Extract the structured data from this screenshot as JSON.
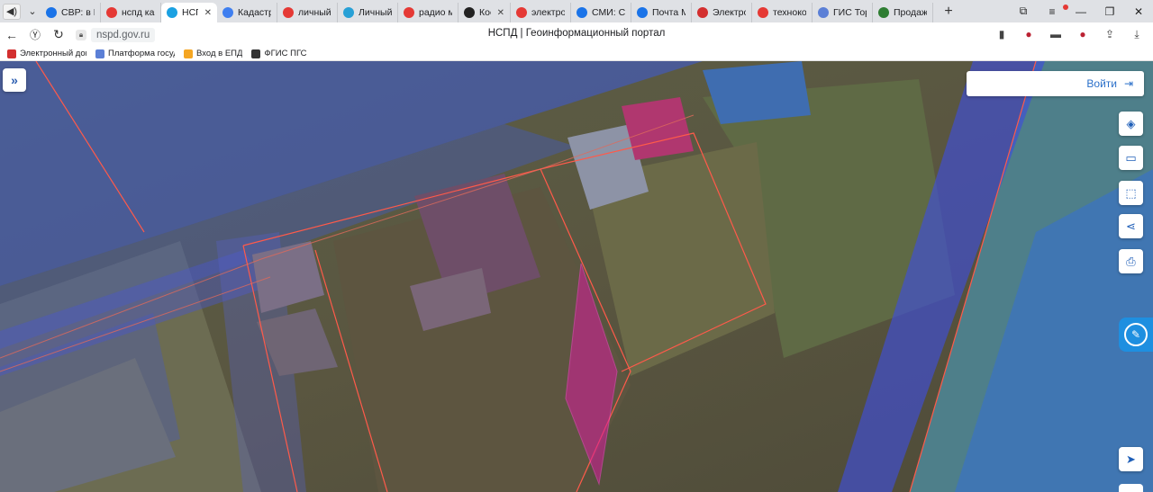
{
  "browser": {
    "tabs": [
      {
        "label": "СВР: в ЕС",
        "favicon": "globe-icon",
        "color": "#1a73e8"
      },
      {
        "label": "нспд кар",
        "favicon": "yandex-icon",
        "color": "#e53935"
      },
      {
        "label": "НСПД",
        "favicon": "nspd-icon",
        "color": "#1ba1e2",
        "active": true,
        "close": "✕"
      },
      {
        "label": "Кадастро",
        "favicon": "map-icon",
        "color": "#3f7ff0"
      },
      {
        "label": "личный",
        "favicon": "yandex-icon",
        "color": "#e53935"
      },
      {
        "label": "Личный",
        "favicon": "gov-icon",
        "color": "#27a0d6"
      },
      {
        "label": "радио м",
        "favicon": "yandex-icon",
        "color": "#e53935"
      },
      {
        "label": "Кос",
        "favicon": "record-icon",
        "color": "#222222",
        "close": "✕"
      },
      {
        "label": "электрон",
        "favicon": "yandex-icon",
        "color": "#e53935"
      },
      {
        "label": "СМИ: СШ",
        "favicon": "globe-icon",
        "color": "#1a73e8"
      },
      {
        "label": "Почта М",
        "favicon": "mail-icon",
        "color": "#1a73e8"
      },
      {
        "label": "Электро",
        "favicon": "doc-icon",
        "color": "#d32f2f"
      },
      {
        "label": "техноко",
        "favicon": "yandex-icon",
        "color": "#e53935"
      },
      {
        "label": "ГИС Тор",
        "favicon": "gov-icon",
        "color": "#5b7fd6"
      },
      {
        "label": "Продажа",
        "favicon": "bars-icon",
        "color": "#2e7d32"
      }
    ],
    "new_tab": "+",
    "url": "nspd.gov.ru",
    "page_title": "НСПД | Геоинформационный портал",
    "bookmarks": [
      {
        "label": "Электронный док",
        "icon": "doc-icon",
        "color": "#d32f2f"
      },
      {
        "label": "Платформа госуд",
        "icon": "gov-icon",
        "color": "#5b7fd6"
      },
      {
        "label": "Вход в ЕПД",
        "icon": "arrow-icon",
        "color": "#f5a623"
      },
      {
        "label": "ФГИС ПГС",
        "icon": "shield-icon",
        "color": "#333333"
      }
    ]
  },
  "map": {
    "login_label": "Войти",
    "colors": {
      "overlay_blue": "#3d5bd9",
      "boundary_red": "#ff5a4a",
      "highlight_magenta": "#d81b9c",
      "tool_icon": "#1f5fb8",
      "helper_bg": "#1e8fe0"
    }
  }
}
